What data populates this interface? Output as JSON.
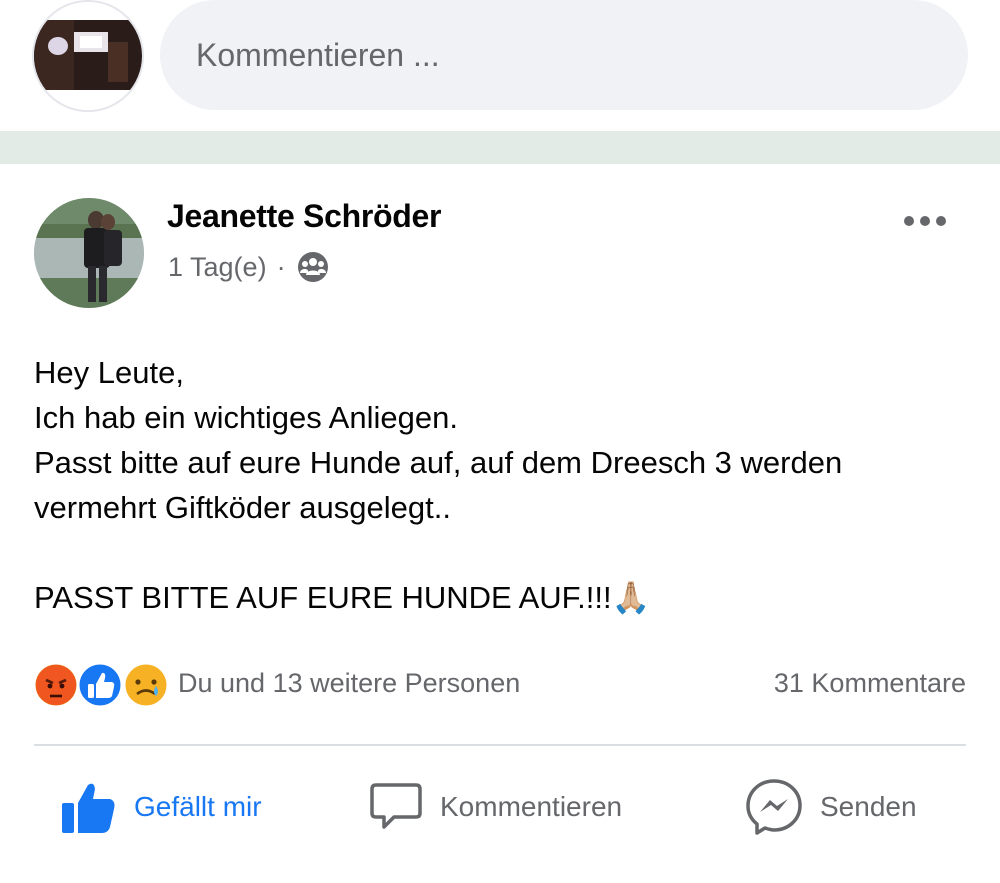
{
  "composer": {
    "placeholder": "Kommentieren ..."
  },
  "post": {
    "author": "Jeanette Schröder",
    "time": "1 Tag(e)",
    "separator": "·",
    "privacy_icon": "group-icon",
    "body_lines": [
      "Hey Leute,",
      "Ich hab ein wichtiges Anliegen.",
      "Passt bitte auf eure Hunde auf, auf dem Dreesch 3 werden",
      "vermehrt Giftköder ausgelegt..",
      "",
      "PASST BITTE AUF EURE HUNDE AUF.!!!🙏🏼"
    ]
  },
  "reactions": {
    "icons": [
      "angry-reaction-icon",
      "like-reaction-icon",
      "sad-reaction-icon"
    ],
    "summary": "Du und 13 weitere Personen",
    "comments": "31 Kommentare"
  },
  "actions": {
    "like": "Gefällt mir",
    "comment": "Kommentieren",
    "send": "Senden"
  },
  "colors": {
    "accent": "#1877f2",
    "muted_text": "#65676b",
    "input_bg": "#f0f2f5",
    "divider_band": "#e3ebe6"
  }
}
